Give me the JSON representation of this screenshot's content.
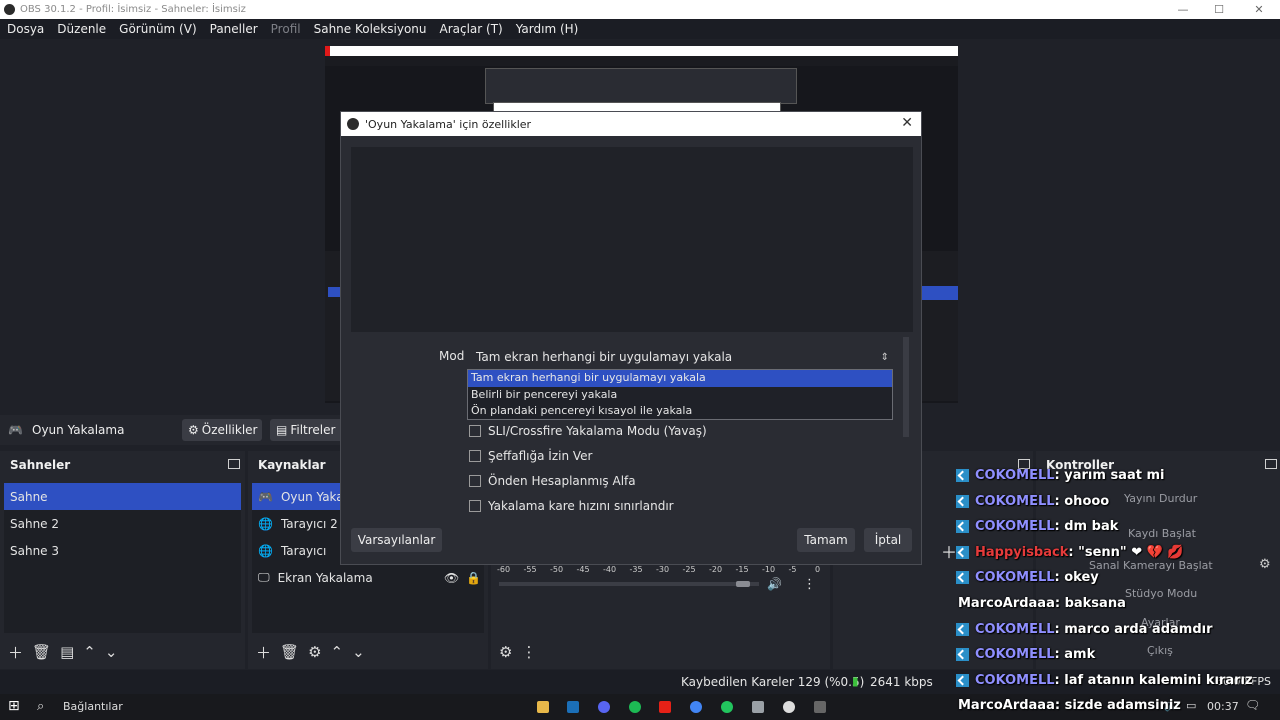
{
  "window": {
    "title": "OBS 30.1.2 - Profil: İsimsiz - Sahneler: İsimsiz"
  },
  "menu": [
    "Dosya",
    "Düzenle",
    "Görünüm (V)",
    "Paneller",
    "Profil",
    "Sahne Koleksiyonu",
    "Araçlar (T)",
    "Yardım (H)"
  ],
  "source_toolbar": {
    "source": "Oyun Yakalama",
    "properties": "Özellikler",
    "filters": "Filtreler"
  },
  "scenes": {
    "title": "Sahneler",
    "items": [
      "Sahne",
      "Sahne 2",
      "Sahne 3"
    ]
  },
  "sources": {
    "title": "Kaynaklar",
    "items": [
      "Oyun Yakala",
      "Tarayıcı 2",
      "Tarayıcı",
      "Ekran Yakalama"
    ]
  },
  "mixer": {
    "ticks": [
      "-60",
      "-55",
      "-50",
      "-45",
      "-40",
      "-35",
      "-30",
      "-25",
      "-20",
      "-15",
      "-10",
      "-5",
      "0"
    ]
  },
  "controls": {
    "title": "Kontroller",
    "items": [
      "Yayını Durdur",
      "Kaydı Başlat",
      "Sanal Kamerayı Başlat",
      "Stüdyo Modu",
      "Ayarlar",
      "Çıkış"
    ]
  },
  "dialog": {
    "title": "'Oyun Yakalama' için özellikler",
    "mode_label": "Mod",
    "mode_value": "Tam ekran herhangi bir uygulamayı yakala",
    "mode_options": [
      "Tam ekran herhangi bir uygulamayı yakala",
      "Belirli bir pencereyi yakala",
      "Ön plandaki pencereyi kısayol ile yakala"
    ],
    "checkboxes": [
      "SLI/Crossfire Yakalama Modu (Yavaş)",
      "Şeffaflığa İzin Ver",
      "Önden Hesaplanmış Alfa",
      "Yakalama kare hızını sınırlandır"
    ],
    "defaults": "Varsayılanlar",
    "ok": "Tamam",
    "cancel": "İptal"
  },
  "chat": [
    {
      "user": "COKOMELL",
      "msg": " : yarım saat mi",
      "icon": true
    },
    {
      "user": "COKOMELL",
      "msg": " : ohooo",
      "icon": true
    },
    {
      "user": "COKOMELL",
      "msg": " : dm bak",
      "icon": true
    },
    {
      "user": "Happyisback",
      "msg": " : \"senn\" ❤ 💔 💋",
      "icon": true,
      "red": true
    },
    {
      "user": "COKOMELL",
      "msg": " : okey",
      "icon": true
    },
    {
      "user": "MarcoArdaaa",
      "msg": " : baksana",
      "icon": false
    },
    {
      "user": "COKOMELL",
      "msg": " : marco arda adamdır",
      "icon": true
    },
    {
      "user": "COKOMELL",
      "msg": " : amk",
      "icon": true
    },
    {
      "user": "COKOMELL",
      "msg": " : laf atanın kalemini kırarız",
      "icon": true
    },
    {
      "user": "MarcoArdaaa",
      "msg": " : sizde adamsiniz",
      "icon": false
    }
  ],
  "status": {
    "dropped": "Kaybedilen Kareler 129 (%0.5)",
    "bitrate": "2641 kbps",
    "fps": "60.00 FPS"
  },
  "taskbar": {
    "search": "Bağlantılar",
    "time": "00:37"
  },
  "colors": {
    "accent": "#2e50c2",
    "chat_user": "#8f8fff",
    "twitch_icon": "#2a8fc8"
  }
}
